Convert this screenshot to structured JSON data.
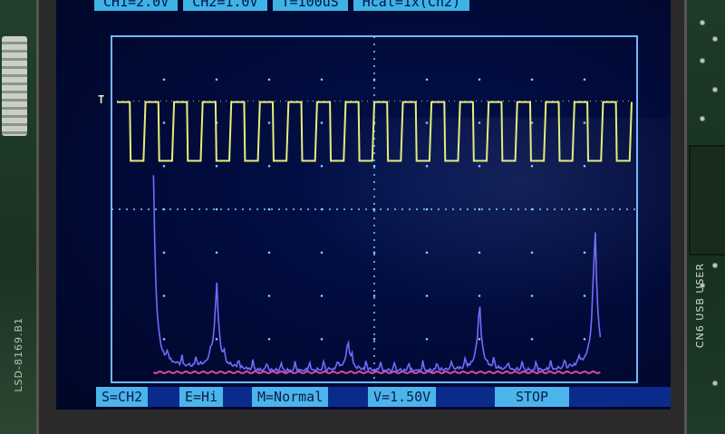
{
  "top_bar": {
    "ch1": "CH1=2.0V",
    "ch2": "CH2=1.0V",
    "timebase": "T=100uS",
    "extra": "Hcal=1x(Ch2)"
  },
  "bottom_bar": {
    "source": "S=CH2",
    "edge": "E=Hi",
    "mode": "M=Normal",
    "level": "V=1.50V",
    "state": "STOP"
  },
  "trigger_marker": "T",
  "board": {
    "left_label": "LSD-8169.B1",
    "right_label": "USB USER",
    "connector_label": "CN6"
  },
  "colors": {
    "ch1_trace": "#e6ee78",
    "ch2_trace": "#6f6cff",
    "ch2_baseline": "#e0489a",
    "grid": "#7fd0ff",
    "frame": "#6fb8ff"
  },
  "chart_data": [
    {
      "type": "line",
      "name": "CH1",
      "description": "square wave, 18 cycles across the screen",
      "cycles": 18
    },
    {
      "type": "line",
      "name": "CH2",
      "description": "FFT spectrum with harmonic peaks",
      "peaks": [
        {
          "pos": 0.08,
          "height": 0.96
        },
        {
          "pos": 0.2,
          "height": 0.48
        },
        {
          "pos": 0.45,
          "height": 0.16
        },
        {
          "pos": 0.7,
          "height": 0.34
        },
        {
          "pos": 0.92,
          "height": 0.78
        }
      ]
    }
  ]
}
